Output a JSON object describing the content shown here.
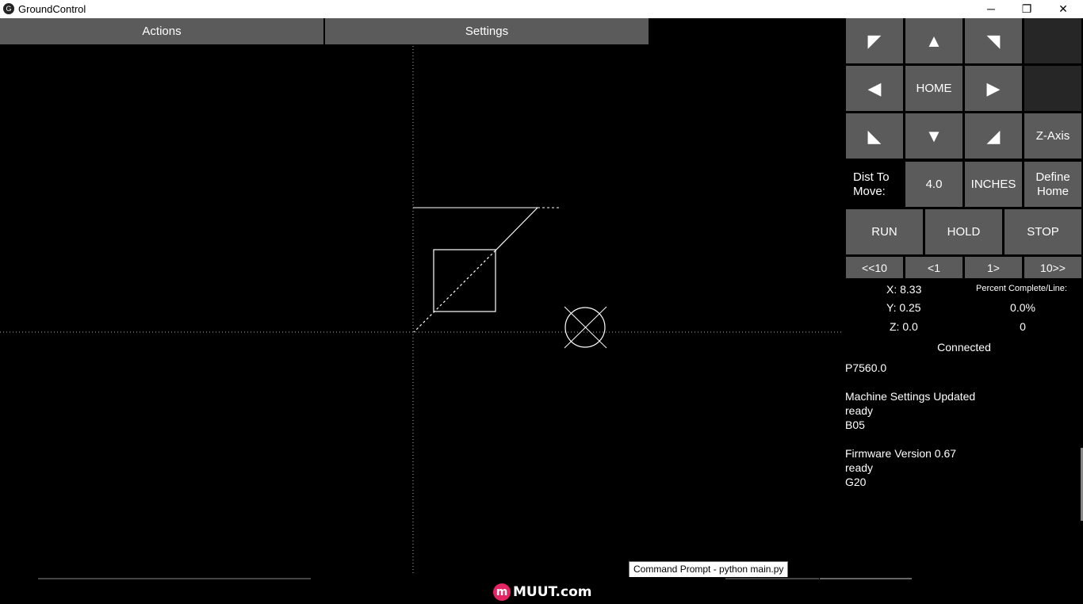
{
  "window": {
    "title": "GroundControl",
    "minimize": "─",
    "restore": "❐",
    "close": "✕"
  },
  "menu": {
    "actions": "Actions",
    "settings": "Settings"
  },
  "jog": {
    "up_left": "◤",
    "up": "▲",
    "up_right": "◥",
    "left": "◀",
    "home": "HOME",
    "right": "▶",
    "down_left": "◣",
    "down": "▼",
    "down_right": "◢",
    "z_axis": "Z-Axis"
  },
  "distance": {
    "label": "Dist To Move:",
    "value": "4.0",
    "units": "INCHES",
    "define_home": "Define Home"
  },
  "run_controls": {
    "run": "RUN",
    "hold": "HOLD",
    "stop": "STOP"
  },
  "step_controls": {
    "back10": "<<10",
    "back1": "<1",
    "fwd1": "1>",
    "fwd10": "10>>"
  },
  "position": {
    "x": "X: 8.33",
    "y": "Y: 0.25",
    "z": "Z: 0.0"
  },
  "progress": {
    "label": "Percent Complete/Line:",
    "percent": "0.0%",
    "line": "0"
  },
  "connection": {
    "status": "Connected"
  },
  "log": [
    "P7560.0",
    "",
    "Machine Settings Updated",
    "ready",
    "B05",
    "",
    "Firmware Version 0.67",
    "ready",
    "G20"
  ],
  "tooltip": "Command Prompt - python  main.py",
  "taskbar": {
    "logo": "m",
    "brand": "MUUT.com"
  }
}
